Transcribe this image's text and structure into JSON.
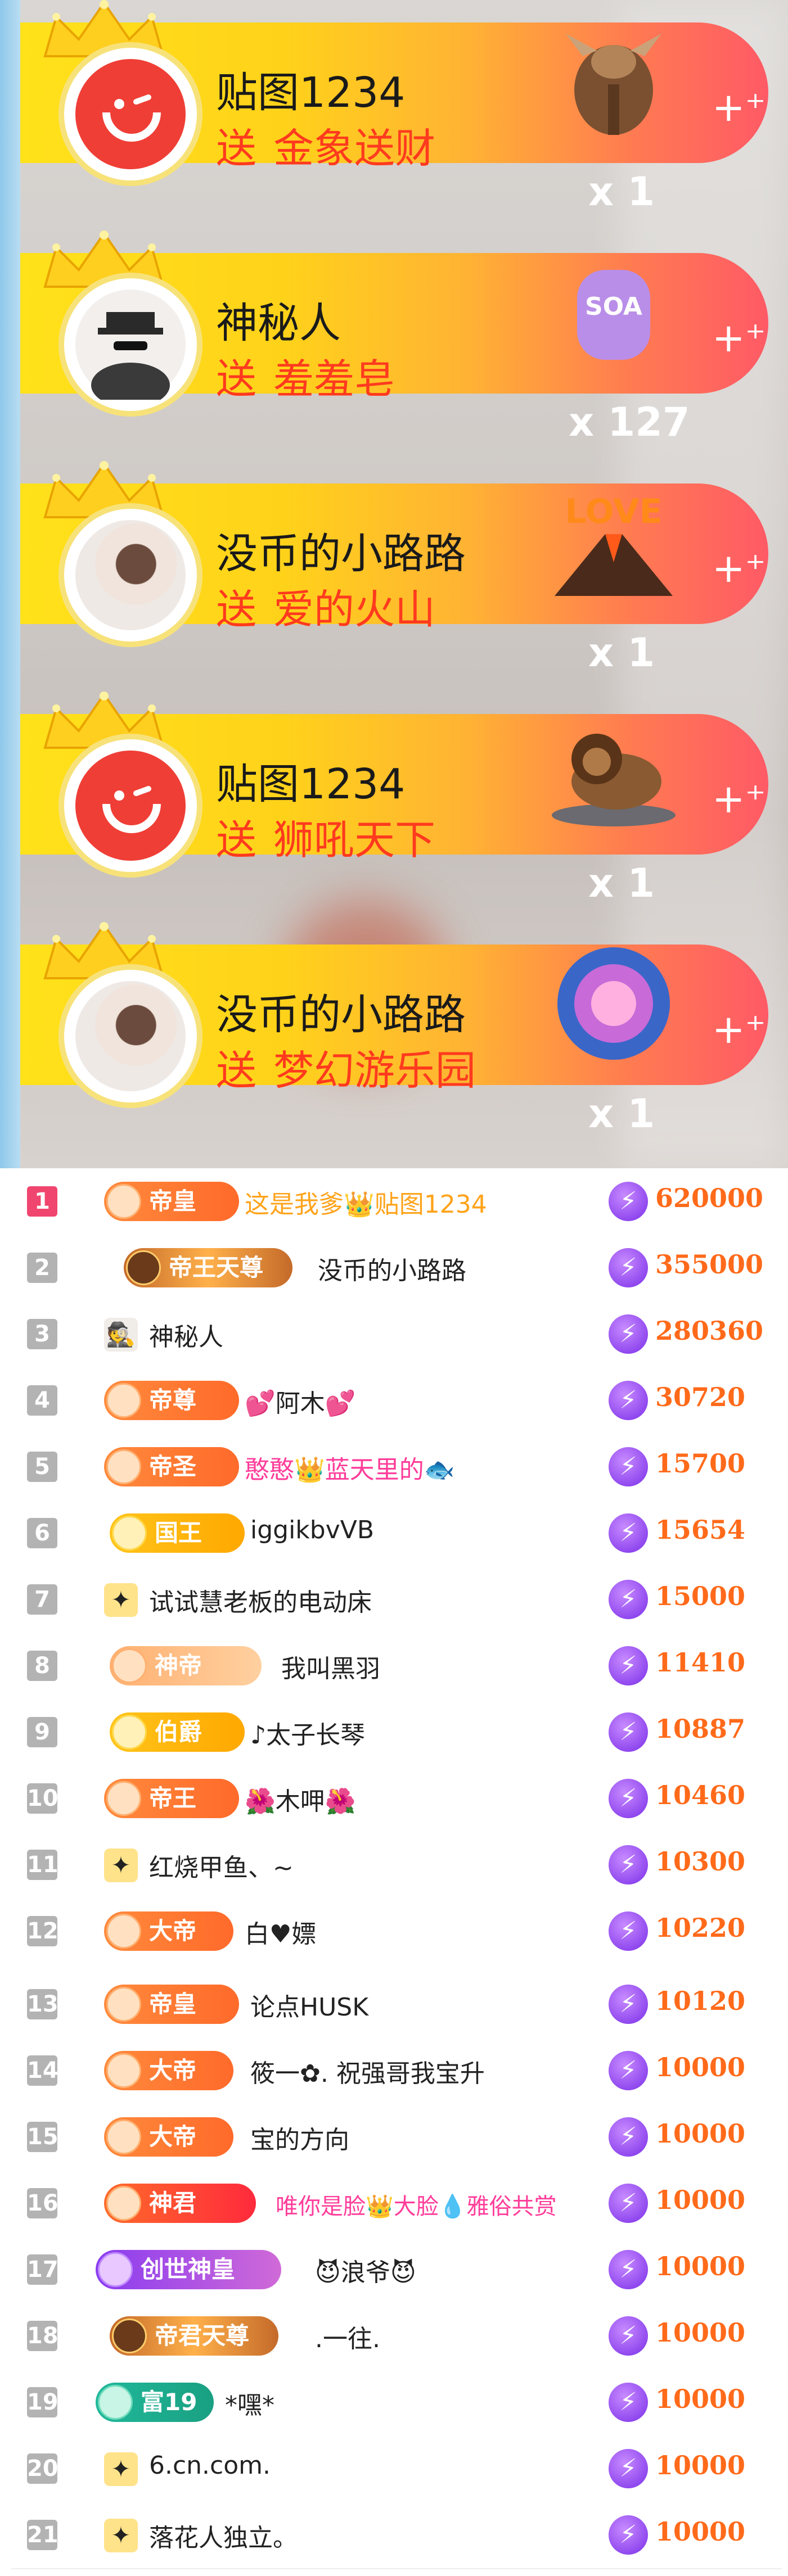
{
  "gifts": [
    {
      "user": "贴图1234",
      "verb": "送",
      "gift": "金象送财",
      "count": "x 1",
      "avatar": "app-logo"
    },
    {
      "user": "神秘人",
      "verb": "送",
      "gift": "羞羞皂",
      "count": "x 127",
      "avatar": "spy"
    },
    {
      "user": "没币的小路路",
      "verb": "送",
      "gift": "爱的火山",
      "count": "x 1",
      "avatar": "girl"
    },
    {
      "user": "贴图1234",
      "verb": "送",
      "gift": "狮吼天下",
      "count": "x 1",
      "avatar": "app-logo"
    },
    {
      "user": "没币的小路路",
      "verb": "送",
      "gift": "梦幻游乐园",
      "count": "x 1",
      "avatar": "girl"
    }
  ],
  "gift_images": [
    "elephant-gift-icon",
    "soap-gift-icon",
    "volcano-gift-icon",
    "lion-gift-icon",
    "amusement-park-gift-icon"
  ],
  "ranking": [
    {
      "rank": "1",
      "badge": "帝皇",
      "name": "这是我爹👑贴图1234",
      "score": "620000"
    },
    {
      "rank": "2",
      "badge": "帝王天尊",
      "name": "没币的小路路",
      "score": "355000"
    },
    {
      "rank": "3",
      "badge": "",
      "name": "神秘人",
      "score": "280360"
    },
    {
      "rank": "4",
      "badge": "帝尊",
      "name": "💕阿木💕",
      "score": "30720"
    },
    {
      "rank": "5",
      "badge": "帝圣",
      "name": "憨憨👑蓝天里的🐟",
      "score": "15700"
    },
    {
      "rank": "6",
      "badge": "国王",
      "name": "iggikbvVB",
      "score": "15654"
    },
    {
      "rank": "7",
      "badge": "",
      "name": "试试慧老板的电动床",
      "score": "15000"
    },
    {
      "rank": "8",
      "badge": "神帝",
      "name": "我叫黑羽",
      "score": "11410"
    },
    {
      "rank": "9",
      "badge": "伯爵",
      "name": "♪太子长琴",
      "score": "10887"
    },
    {
      "rank": "10",
      "badge": "帝王",
      "name": "🌺木呷🌺",
      "score": "10460"
    },
    {
      "rank": "11",
      "badge": "",
      "name": "红烧甲鱼、~",
      "score": "10300"
    },
    {
      "rank": "12",
      "badge": "大帝",
      "name": "白♥嫖",
      "score": "10220"
    },
    {
      "rank": "13",
      "badge": "帝皇",
      "name": "论点HUSK",
      "score": "10120"
    },
    {
      "rank": "14",
      "badge": "大帝",
      "name": "筱一✿. 祝强哥我宝升",
      "score": "10000"
    },
    {
      "rank": "15",
      "badge": "大帝",
      "name": "宝的方向",
      "score": "10000"
    },
    {
      "rank": "16",
      "badge": "神君",
      "name": "唯你是脸👑大脸💧雅俗共赏",
      "score": "10000"
    },
    {
      "rank": "17",
      "badge": "创世神皇",
      "name": "😈浪爷😈",
      "score": "10000"
    },
    {
      "rank": "18",
      "badge": "帝君天尊",
      "name": ".一往.",
      "score": "10000"
    },
    {
      "rank": "19",
      "badge": "富19",
      "name": "*嘿*",
      "score": "10000"
    },
    {
      "rank": "20",
      "badge": "",
      "name": "6.cn.com.",
      "score": "10000"
    },
    {
      "rank": "21",
      "badge": "",
      "name": "落花人独立。",
      "score": "10000"
    }
  ],
  "colors": {
    "accent": "#ff6a1a",
    "gift_text": "#ff3a1e",
    "rank_first": "#f0456e"
  }
}
